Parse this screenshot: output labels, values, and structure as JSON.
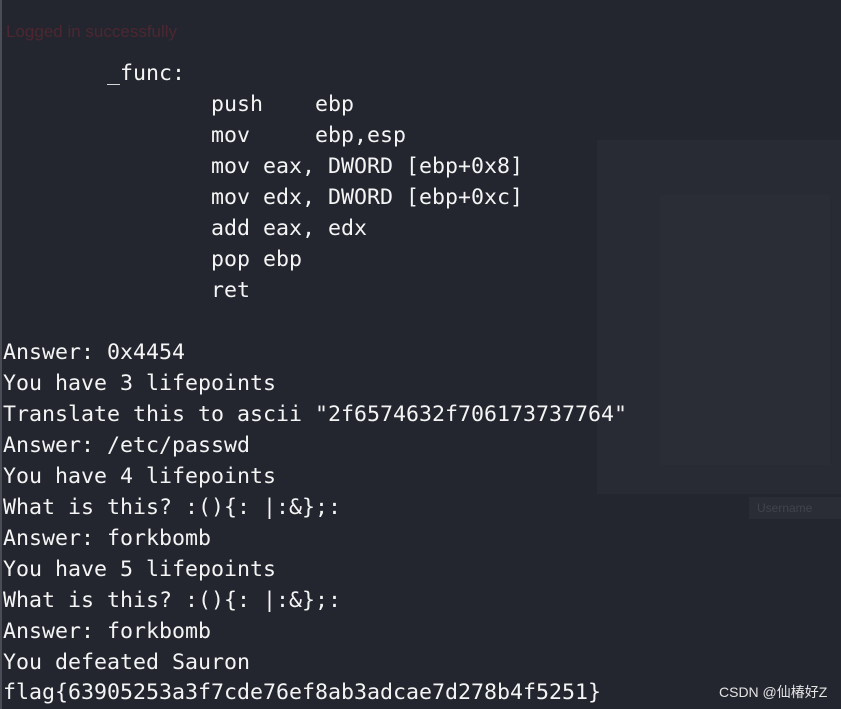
{
  "terminal": {
    "status_ghost": "Logged in successfully",
    "lines": [
      "        _func:",
      "                push    ebp",
      "                mov     ebp,esp",
      "                mov eax, DWORD [ebp+0x8]",
      "                mov edx, DWORD [ebp+0xc]",
      "                add eax, edx",
      "                pop ebp",
      "                ret",
      "",
      "Answer: 0x4454",
      "You have 3 lifepoints",
      "Translate this to ascii \"2f6574632f706173737764\"",
      "Answer: /etc/passwd",
      "You have 4 lifepoints",
      "What is this? :(){: |:&};:",
      "Answer: forkbomb",
      "You have 5 lifepoints",
      "What is this? :(){: |:&};:",
      "Answer: forkbomb",
      "You defeated Sauron",
      "flag{63905253a3f7cde76ef8ab3adcae7d278b4f5251}"
    ]
  },
  "ghost_input_placeholder": "Username",
  "watermark": "CSDN @仙椿好Z",
  "colors": {
    "background": "#23262f",
    "text": "#f4f4f4"
  }
}
